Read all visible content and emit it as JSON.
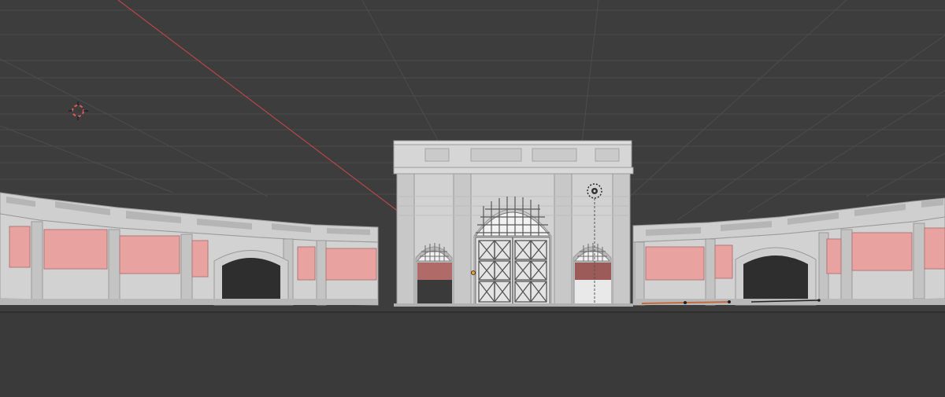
{
  "viewport": {
    "background": "#3d3d3d",
    "floor_color": "#3a3a3a",
    "grid_color": "#4a4a4a",
    "x_axis_color": "#c04646",
    "model_color": "#cfcfcf",
    "model_shadow": "#a9a9a9",
    "panel_color": "#e8a3a0",
    "dark_color": "#2b2b2b"
  },
  "icons": {
    "cursor": "3d-cursor-icon",
    "light": "light-object-icon",
    "origin": "object-origin-icon"
  }
}
